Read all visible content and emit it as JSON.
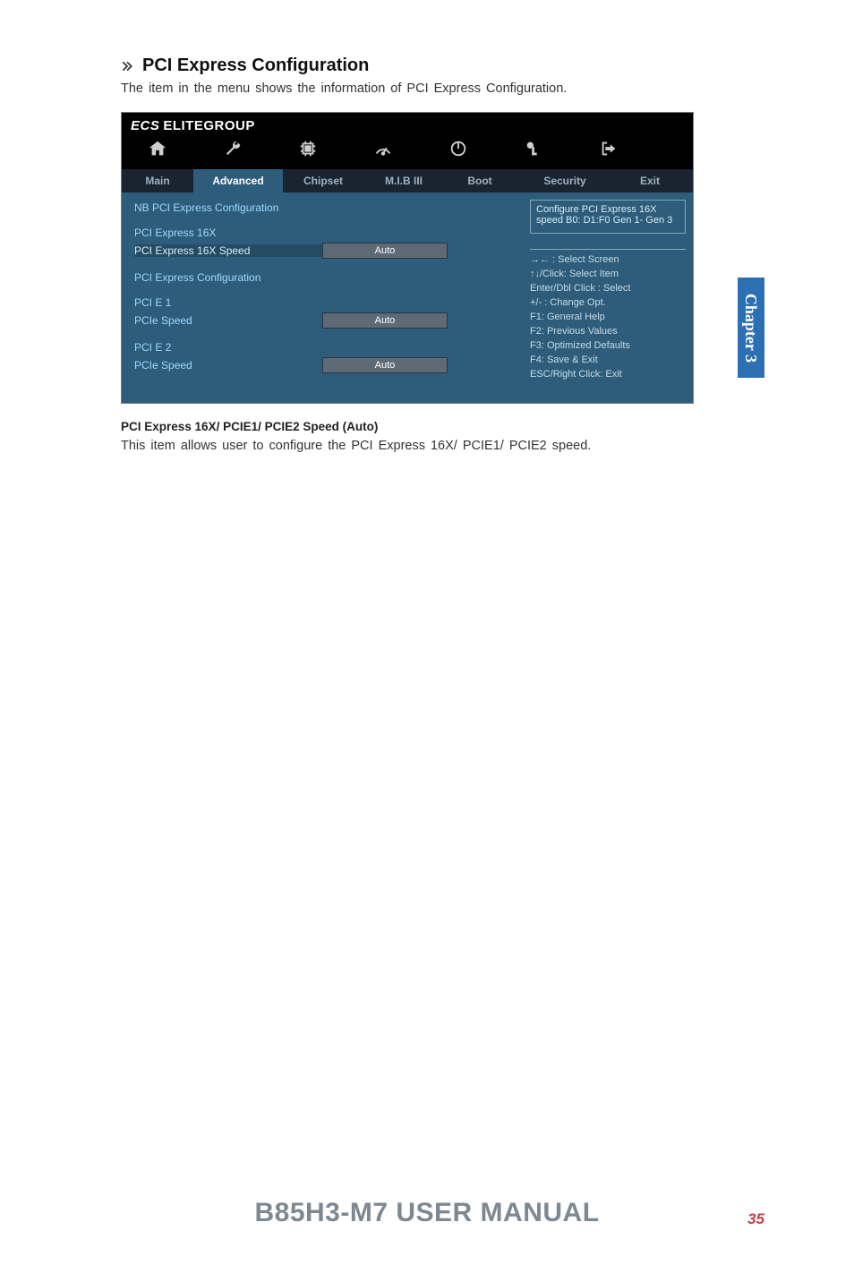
{
  "heading": {
    "title": "PCI Express Configuration"
  },
  "intro": "The item in the menu shows the information of PCI Express Configuration.",
  "bios": {
    "brand": "ELITEGROUP",
    "tabs": {
      "main": "Main",
      "advanced": "Advanced",
      "chipset": "Chipset",
      "mib": "M.I.B III",
      "boot": "Boot",
      "security": "Security",
      "exit": "Exit"
    },
    "left": {
      "nb_title": "NB PCI Express Configuration",
      "pcie16x_label": "PCI Express 16X",
      "pcie16x_speed_label": "PCI Express 16X Speed",
      "pcie16x_speed_value": "Auto",
      "pci_config_label": "PCI Express Configuration",
      "pcie1_label": "PCI E 1",
      "pcie1_speed_label": "PCIe Speed",
      "pcie1_speed_value": "Auto",
      "pcie2_label": "PCI E 2",
      "pcie2_speed_label": "PCIe  Speed",
      "pcie2_speed_value": "Auto"
    },
    "right": {
      "help": "Configure PCI Express 16X speed B0: D1:F0 Gen 1- Gen 3",
      "k_select_screen": "→←    : Select Screen",
      "k_select_item": "↑↓/Click: Select Item",
      "k_enter": "Enter/Dbl Click : Select",
      "k_change": "+/- : Change Opt.",
      "k_f1": "F1: General Help",
      "k_f2": "F2: Previous Values",
      "k_f3": "F3: Optimized Defaults",
      "k_f4": "F4: Save & Exit",
      "k_esc": "ESC/Right Click: Exit"
    }
  },
  "sub_heading": "PCI Express 16X/ PCIE1/ PCIE2 Speed (Auto)",
  "body_text": "This item allows user to configure the PCI Express 16X/ PCIE1/ PCIE2 speed.",
  "side_tab": "Chapter 3",
  "footer_title": "B85H3-M7 USER MANUAL",
  "page_number": "35"
}
